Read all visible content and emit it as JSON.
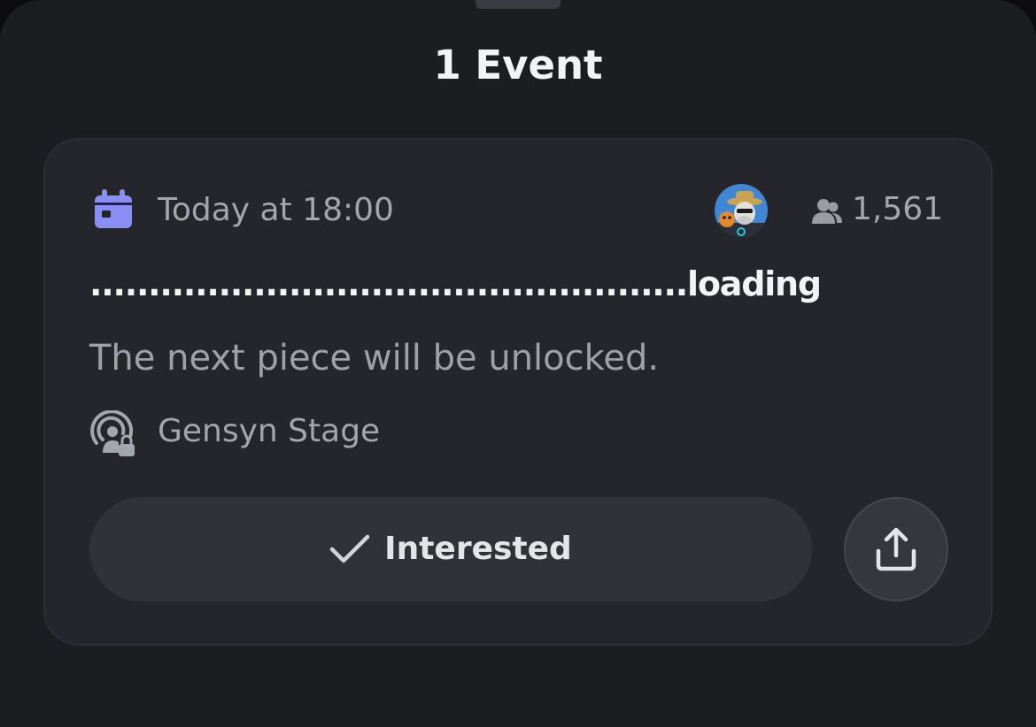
{
  "sheet": {
    "title": "1 Event"
  },
  "event": {
    "date": "Today at 18:00",
    "interested_count": "1,561",
    "name": "...................................................loading",
    "description": "The next piece will be unlocked.",
    "location": "Gensyn Stage",
    "interested_label": "Interested"
  },
  "icons": {
    "calendar": "calendar-icon",
    "people": "people-icon",
    "stage": "stage-channel-locked-icon",
    "check": "checkmark-icon",
    "share": "share-icon"
  },
  "colors": {
    "background": "#1c1d21",
    "card": "#25262b",
    "accent_calendar": "#8b8ff5",
    "text_primary": "#f2f3f5",
    "text_muted": "#a4a6ad",
    "button": "#313238"
  }
}
